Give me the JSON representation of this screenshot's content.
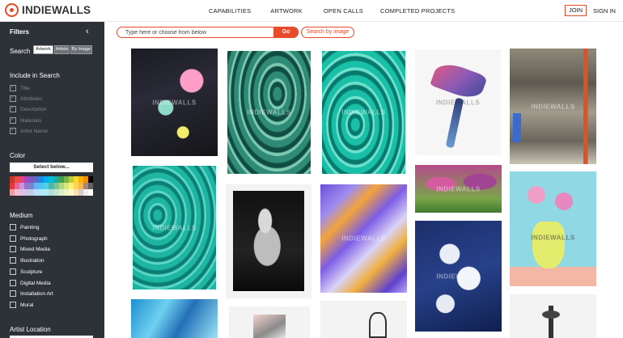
{
  "header": {
    "logo_text": "INDIEWALLS",
    "nav": [
      "CAPABILITIES",
      "ARTWORK",
      "OPEN CALLS",
      "COMPLETED PROJECTS"
    ],
    "join_label": "JOIN",
    "signin_label": "SIGN IN"
  },
  "sidebar": {
    "title": "Filters",
    "search_label": "Search",
    "search_modes": [
      "Artwork",
      "Artists",
      "By Image"
    ],
    "include_title": "Include in Search",
    "include_items": [
      "Title",
      "Attributes",
      "Description",
      "Materials",
      "Artist Name"
    ],
    "color_title": "Color",
    "color_button": "Select below...",
    "palette": [
      "#c0392b",
      "#e74c3c",
      "#ec407a",
      "#ab47bc",
      "#7e57c2",
      "#5c6bc0",
      "#1e88e5",
      "#03a9f4",
      "#00bcd4",
      "#26a69a",
      "#43a047",
      "#7cb342",
      "#c0ca33",
      "#fdd835",
      "#ffb300",
      "#fb8c00",
      "#000000",
      "#e53935",
      "#f06292",
      "#ce93d8",
      "#9575cd",
      "#7986cb",
      "#64b5f6",
      "#4fc3f7",
      "#4dd0e1",
      "#4db6ac",
      "#81c784",
      "#aed581",
      "#dce775",
      "#fff176",
      "#ffd54f",
      "#ffb74d",
      "#a1887f",
      "#616161",
      "#ef9a9a",
      "#f8bbd0",
      "#e1bee7",
      "#d1c4e9",
      "#c5cae9",
      "#bbdefb",
      "#b3e5fc",
      "#b2ebf2",
      "#b2dfdb",
      "#c8e6c9",
      "#dcedc8",
      "#f0f4c3",
      "#fff9c4",
      "#ffe0b2",
      "#d7ccc8",
      "#eeeeee",
      "#ffffff"
    ],
    "medium_title": "Medium",
    "medium_items": [
      "Painting",
      "Photograph",
      "Mixed Media",
      "Illustration",
      "Sculpture",
      "Digital Media",
      "Installation Art",
      "Mural"
    ],
    "artist_location_title": "Artist Location"
  },
  "search": {
    "placeholder": "Type here or choose from below",
    "go_label": "Go",
    "by_image_label": "Search by image"
  },
  "watermark": "INDIEWALLS"
}
